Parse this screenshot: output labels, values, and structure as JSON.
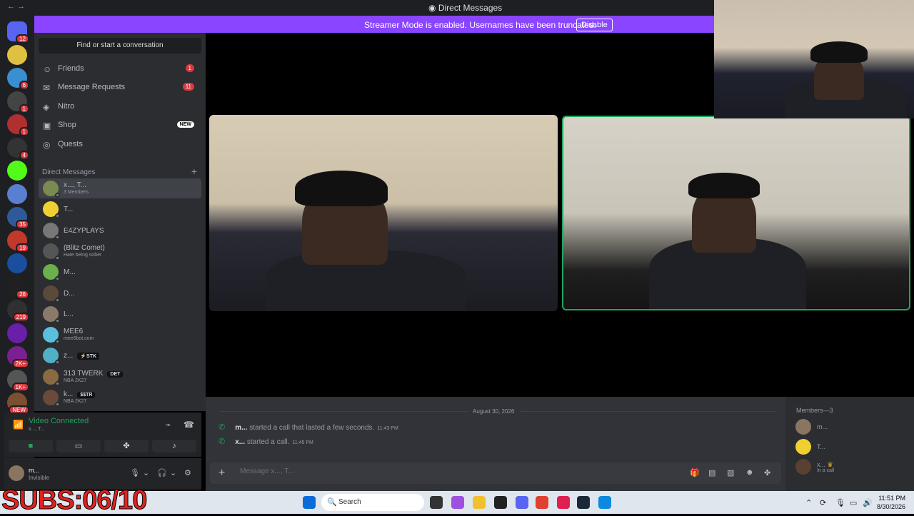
{
  "window": {
    "title": "Direct Messages",
    "nav_arrows": "←  →"
  },
  "banner": {
    "text": "Streamer Mode is enabled. Usernames have been truncated.",
    "button": "Disable"
  },
  "guilds": [
    {
      "badge": "12",
      "color": "#5865f2"
    },
    {
      "badge": "",
      "color": "#e0c040"
    },
    {
      "badge": "6",
      "color": "#3a8fd0"
    },
    {
      "badge": "1",
      "color": "#444"
    },
    {
      "badge": "1",
      "color": "#b03030"
    },
    {
      "badge": "4",
      "color": "#333"
    },
    {
      "badge": "",
      "color": "#53fc18"
    },
    {
      "badge": "",
      "color": "#5a7fd0"
    },
    {
      "badge": "35",
      "color": "#2e5a9c"
    },
    {
      "badge": "19",
      "color": "#c0392b"
    },
    {
      "badge": "",
      "color": "#1a4fa0"
    },
    {
      "badge": "26",
      "color": "#202020"
    },
    {
      "badge": "219",
      "color": "#303030"
    },
    {
      "badge": "",
      "color": "#6a1fa8"
    },
    {
      "badge": "2K+",
      "color": "#7a2090"
    },
    {
      "badge": "1K+",
      "color": "#555"
    },
    {
      "badge": "NEW",
      "color": "#7a5030"
    }
  ],
  "sidebar": {
    "search_label": "Find or start a conversation",
    "nav": [
      {
        "label": "Friends",
        "count": "1",
        "new": ""
      },
      {
        "label": "Message Requests",
        "count": "11",
        "new": ""
      },
      {
        "label": "Nitro",
        "count": "",
        "new": ""
      },
      {
        "label": "Shop",
        "count": "",
        "new": "NEW"
      },
      {
        "label": "Quests",
        "count": "",
        "new": ""
      }
    ],
    "dm_header": "Direct Messages",
    "dms": [
      {
        "name": "x..., T...",
        "sub": "3 Members",
        "tag": ""
      },
      {
        "name": "T...",
        "sub": "",
        "tag": ""
      },
      {
        "name": "E4ZYPLAYS",
        "sub": "",
        "tag": ""
      },
      {
        "name": "(Blitz Comet)",
        "sub": "Hate being sober",
        "tag": ""
      },
      {
        "name": "M...",
        "sub": "",
        "tag": ""
      },
      {
        "name": "D...",
        "sub": "",
        "tag": ""
      },
      {
        "name": "L...",
        "sub": "",
        "tag": ""
      },
      {
        "name": "MEE6",
        "sub": "mee6bot.com",
        "tag": ""
      },
      {
        "name": "z...",
        "sub": "",
        "tag": "⚡STK"
      },
      {
        "name": "313 TWERK",
        "sub": "NBA 2K27",
        "tag": "DET"
      },
      {
        "name": "k...",
        "sub": "NBA 2K27",
        "tag": "$$TR"
      }
    ]
  },
  "voice": {
    "status": "Video Connected",
    "channel": "x..., T..."
  },
  "user": {
    "name": "m...",
    "status": "Invisible"
  },
  "chat": {
    "date": "August 30, 2026",
    "messages": [
      {
        "user": "m...",
        "text": "started a call that lasted a few seconds.",
        "time": "11:43 PM"
      },
      {
        "user": "x...",
        "text": "started a call.",
        "time": "11:45 PM"
      }
    ],
    "composer_placeholder": "Message x..., T..."
  },
  "members": {
    "header": "Members—3",
    "list": [
      {
        "name": "m...",
        "sub": ""
      },
      {
        "name": "T...",
        "sub": ""
      },
      {
        "name": "x...",
        "sub": "In a call"
      }
    ]
  },
  "taskbar": {
    "search": "Search",
    "time": "11:51 PM",
    "date": "8/30/2026"
  },
  "overlay": {
    "subs": "SUBS:06/10"
  },
  "colors": {
    "accent": "#5865f2",
    "banner": "#8945ff",
    "online": "#23a55a",
    "badge": "#da373c"
  }
}
